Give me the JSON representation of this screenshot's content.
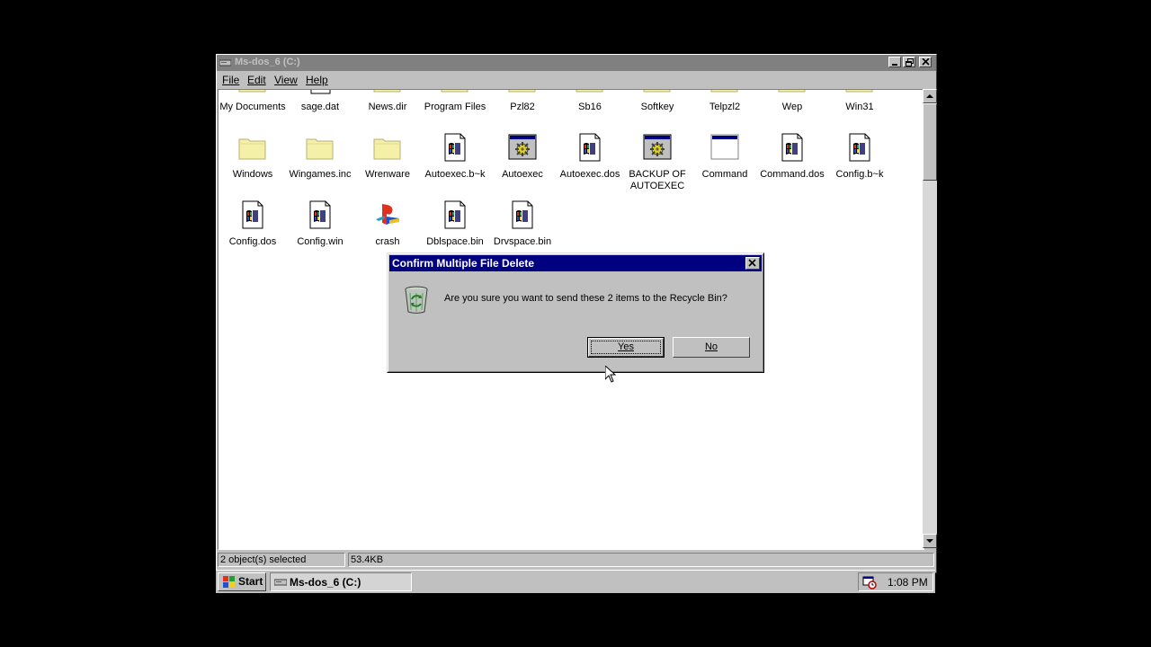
{
  "window": {
    "title": "Ms-dos_6 (C:)",
    "menu": [
      "File",
      "Edit",
      "View",
      "Help"
    ]
  },
  "icons": [
    {
      "label": "My Documents",
      "type": "folder"
    },
    {
      "label": "sage.dat",
      "type": "doc"
    },
    {
      "label": "News.dir",
      "type": "folder"
    },
    {
      "label": "Program Files",
      "type": "folder"
    },
    {
      "label": "Pzl82",
      "type": "folder"
    },
    {
      "label": "Sb16",
      "type": "folder"
    },
    {
      "label": "Softkey",
      "type": "folder"
    },
    {
      "label": "Telpzl2",
      "type": "folder"
    },
    {
      "label": "Wep",
      "type": "folder"
    },
    {
      "label": "Win31",
      "type": "folder"
    },
    {
      "label": "Windows",
      "type": "folder"
    },
    {
      "label": "Wingames.inc",
      "type": "folder"
    },
    {
      "label": "Wrenware",
      "type": "folder"
    },
    {
      "label": "Autoexec.b~k",
      "type": "sysfile"
    },
    {
      "label": "Autoexec",
      "type": "gearwin"
    },
    {
      "label": "Autoexec.dos",
      "type": "sysfile"
    },
    {
      "label": "BACKUP OF AUTOEXEC",
      "type": "gearwin"
    },
    {
      "label": "Command",
      "type": "app"
    },
    {
      "label": "Command.dos",
      "type": "sysfile"
    },
    {
      "label": "Config.b~k",
      "type": "sysfile"
    },
    {
      "label": "Config.dos",
      "type": "sysfile"
    },
    {
      "label": "Config.win",
      "type": "sysfile"
    },
    {
      "label": "crash",
      "type": "ps"
    },
    {
      "label": "Dblspace.bin",
      "type": "sysfile"
    },
    {
      "label": "Drvspace.bin",
      "type": "sysfile"
    }
  ],
  "status": {
    "selected": "2 object(s) selected",
    "size": "53.4KB"
  },
  "dialog": {
    "title": "Confirm Multiple File Delete",
    "message": "Are you sure you want to send these 2 items to the Recycle Bin?",
    "yes": "Yes",
    "no": "No"
  },
  "taskbar": {
    "start": "Start",
    "task": "Ms-dos_6 (C:)",
    "time": "1:08 PM"
  },
  "colors": {
    "inactive_title": "#808080",
    "active_title": "#000080",
    "face": "#c0c0c0",
    "folder": "#f5f0a8"
  }
}
